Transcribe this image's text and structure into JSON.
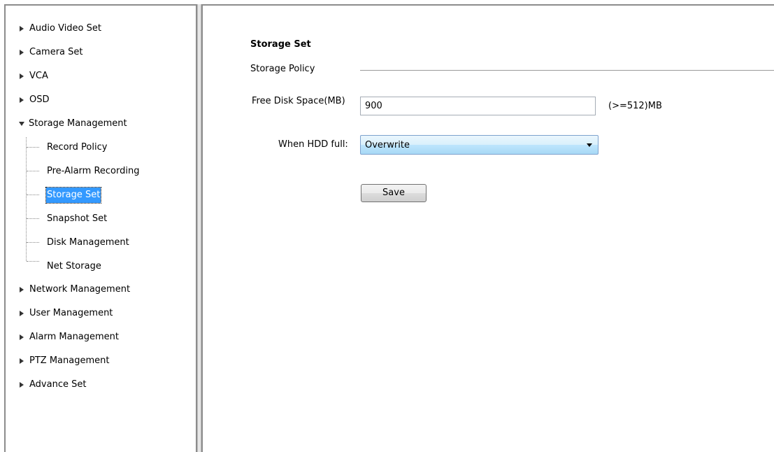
{
  "sidebar": {
    "top_items": [
      {
        "label": "Audio Video Set",
        "icon": "triangle-right-icon"
      },
      {
        "label": "Camera Set",
        "icon": "triangle-right-icon"
      },
      {
        "label": "VCA",
        "icon": "triangle-right-icon"
      },
      {
        "label": "OSD",
        "icon": "triangle-right-icon"
      }
    ],
    "expanded_item": {
      "label": "Storage Management",
      "icon": "triangle-down-icon"
    },
    "sub_items": [
      {
        "label": "Record Policy"
      },
      {
        "label": "Pre-Alarm Recording"
      },
      {
        "label": "Storage Set",
        "selected": true
      },
      {
        "label": "Snapshot Set"
      },
      {
        "label": "Disk Management"
      },
      {
        "label": "Net Storage"
      }
    ],
    "bottom_items": [
      {
        "label": "Network Management",
        "icon": "triangle-right-icon"
      },
      {
        "label": "User Management",
        "icon": "triangle-right-icon"
      },
      {
        "label": "Alarm Management",
        "icon": "triangle-right-icon"
      },
      {
        "label": "PTZ Management",
        "icon": "triangle-right-icon"
      },
      {
        "label": "Advance Set",
        "icon": "triangle-right-icon"
      }
    ]
  },
  "main": {
    "title": "Storage Set",
    "policy_section": "Storage Policy",
    "free_disk": {
      "label": "Free Disk Space(MB)",
      "value": "900",
      "hint": "(>=512)MB"
    },
    "hdd_full": {
      "label": "When HDD full:",
      "selected": "Overwrite"
    },
    "save_label": "Save"
  },
  "colors": {
    "selection": "#3399ff",
    "frame": "#8c8c8c"
  }
}
